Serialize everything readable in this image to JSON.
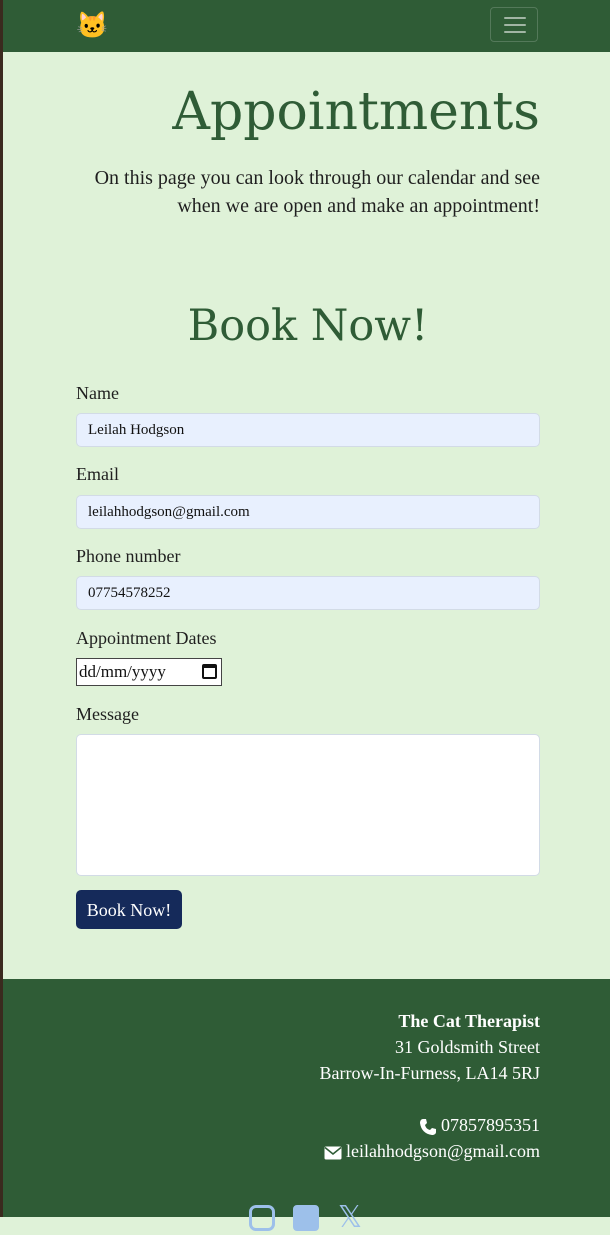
{
  "header": {
    "brand_icon": "🐱",
    "brand_icon_name": "cat-face-icon",
    "menu_icon_name": "hamburger-menu-icon"
  },
  "main": {
    "title": "Appointments",
    "intro": "On this page you can look through our calendar and see when we are open and make an appointment!",
    "form_title": "Book Now!",
    "form": {
      "name_label": "Name",
      "name_value": "Leilah Hodgson",
      "email_label": "Email",
      "email_value": "leilahhodgson@gmail.com",
      "phone_label": "Phone number",
      "phone_value": "07754578252",
      "date_label": "Appointment Dates",
      "date_placeholder": "dd/mm/yyyy",
      "message_label": "Message",
      "message_value": "",
      "submit_label": "Book Now!"
    }
  },
  "footer": {
    "business_name": "The Cat Therapist",
    "address_line1": "31 Goldsmith Street",
    "address_line2": "Barrow-In-Furness, LA14 5RJ",
    "phone": "07857895351",
    "email": "leilahhodgson@gmail.com",
    "social": [
      "instagram-icon",
      "facebook-icon",
      "x-twitter-icon"
    ]
  },
  "colors": {
    "navbar": "#2f5c36",
    "background": "#dff2d8",
    "heading": "#2f5c36",
    "button": "#152a5a",
    "input_fill": "#e8f0fe",
    "social_icons": "#9dc0ea"
  }
}
